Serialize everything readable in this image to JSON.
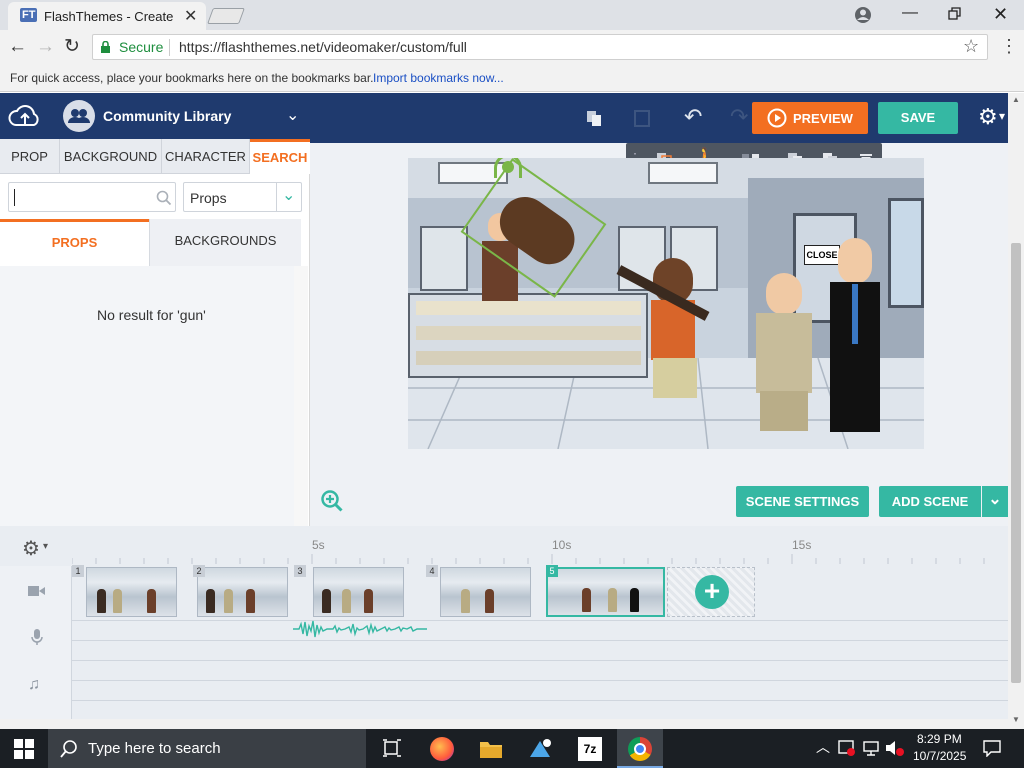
{
  "browser": {
    "tab_title": "FlashThemes - Create",
    "tab_favicon_text": "FT",
    "secure_label": "Secure",
    "url": "https://flashthemes.net/videomaker/custom/full",
    "bookmarks_prompt": "For quick access, place your bookmarks here on the bookmarks bar.",
    "bookmarks_link": "Import bookmarks now..."
  },
  "app": {
    "library_label": "Community Library",
    "tabs": [
      "PROP",
      "BACKGROUND",
      "CHARACTER",
      "SEARCH"
    ],
    "active_tab": "SEARCH",
    "search_value": "",
    "filter_select": "Props",
    "subtabs": [
      "PROPS",
      "BACKGROUNDS"
    ],
    "active_subtab": "PROPS",
    "no_result": "No result for 'gun'",
    "preview_label": "PREVIEW",
    "save_label": "SAVE",
    "scene_settings_label": "SCENE SETTINGS",
    "add_scene_label": "ADD SCENE",
    "stage_sign_text": "CLOSE"
  },
  "timeline": {
    "ruler": [
      "5s",
      "10s",
      "15s"
    ],
    "scenes": [
      "1",
      "2",
      "3",
      "4",
      "5"
    ],
    "selected_scene": "5"
  },
  "taskbar": {
    "search_placeholder": "Type here to search",
    "time": "8:29 PM",
    "date": "10/7/2025",
    "app_7z": "7z"
  },
  "colors": {
    "app_navy": "#1f3a6e",
    "accent_orange": "#f36f21",
    "accent_teal": "#35b8a3",
    "chrome_gray": "#dee1e6"
  }
}
